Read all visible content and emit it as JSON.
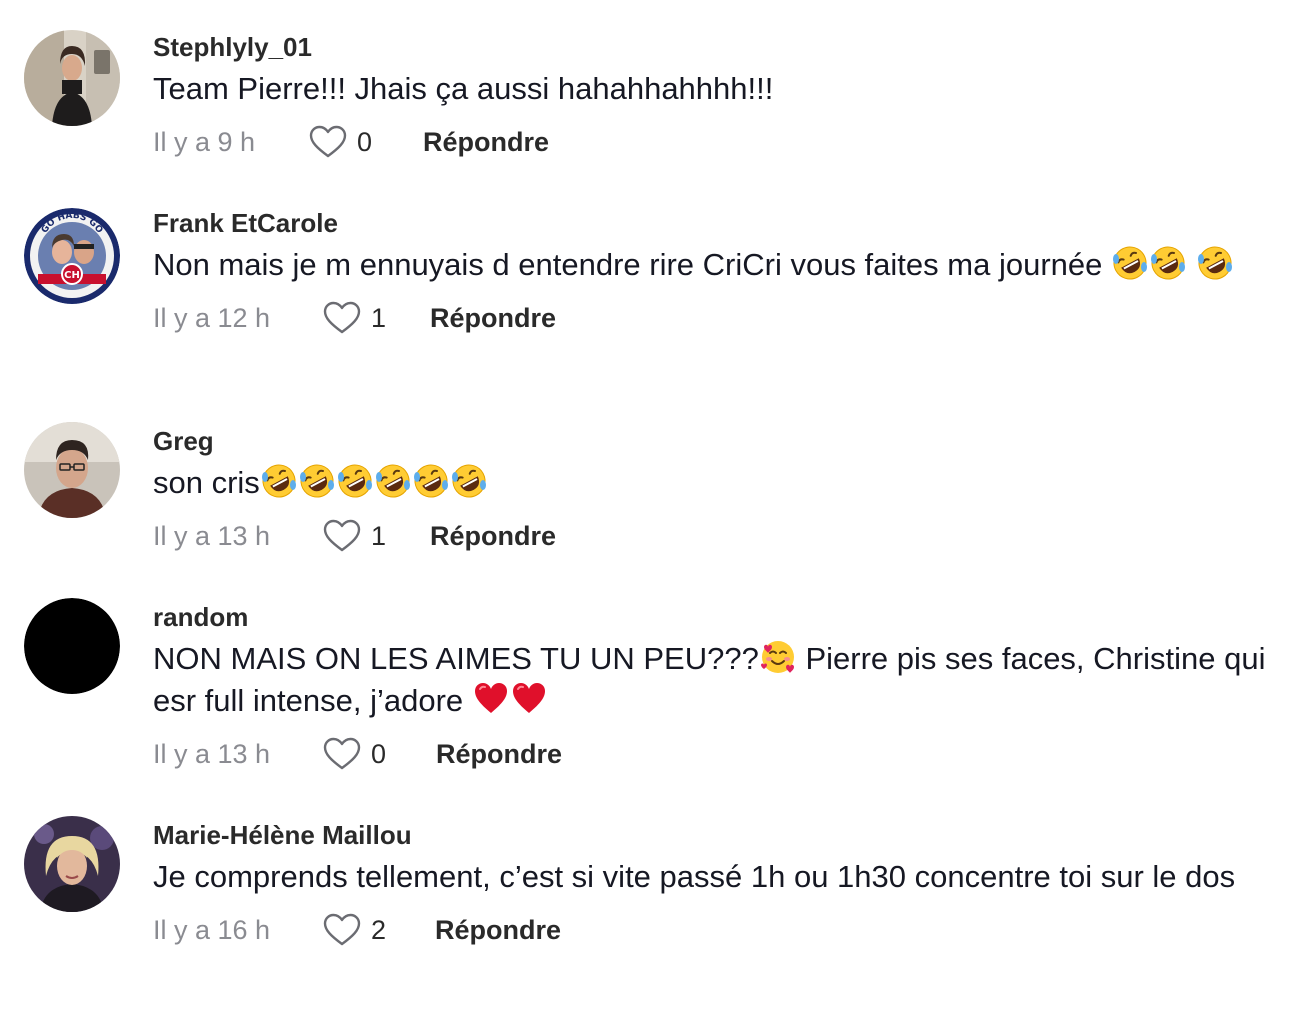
{
  "comments": [
    {
      "username": "Stephlyly_01",
      "text": "Team Pierre!!! Jhais ça aussi hahahhahhhh!!!",
      "time": "Il y a 9 h",
      "likes": "0",
      "reply_label": "Répondre",
      "avatar_icon": "woman-mirror-selfie-photo"
    },
    {
      "username": "Frank EtCarole",
      "text": "Non mais je m ennuyais d entendre rire CriCri vous faites ma journée",
      "emoji_icon": "rolling-on-floor-laughing-emoji",
      "time": "Il y a 12 h",
      "likes": "1",
      "reply_label": "Répondre",
      "avatar_icon": "go-habs-go-badge-photo",
      "avatar_text": "GO HABS GO"
    },
    {
      "username": "Greg",
      "text": "son cris",
      "emoji_icon": "rolling-on-floor-laughing-emoji",
      "time": "Il y a 13 h",
      "likes": "1",
      "reply_label": "Répondre",
      "avatar_icon": "man-portrait-photo"
    },
    {
      "username": "random",
      "text_part1": "NON MAIS ON LES AIMES TU UN PEU???",
      "text_part2": " Pierre pis ses faces, Christine qui esr full intense, j’adore ",
      "emoji_icons": [
        "smiling-face-with-hearts-emoji",
        "red-heart-emoji"
      ],
      "time": "Il y a 13 h",
      "likes": "0",
      "reply_label": "Répondre",
      "avatar_icon": "black-avatar"
    },
    {
      "username": "Marie-Hélène Maillou",
      "text": "Je comprends tellement, c’est si vite passé 1h ou 1h30 concentre toi sur le dos",
      "time": "Il y a 16 h",
      "likes": "2",
      "reply_label": "Répondre",
      "avatar_icon": "woman-blonde-portrait-photo"
    }
  ],
  "colors": {
    "username": "#2a2a2a",
    "text": "#161823",
    "meta": "#8a8b91"
  }
}
